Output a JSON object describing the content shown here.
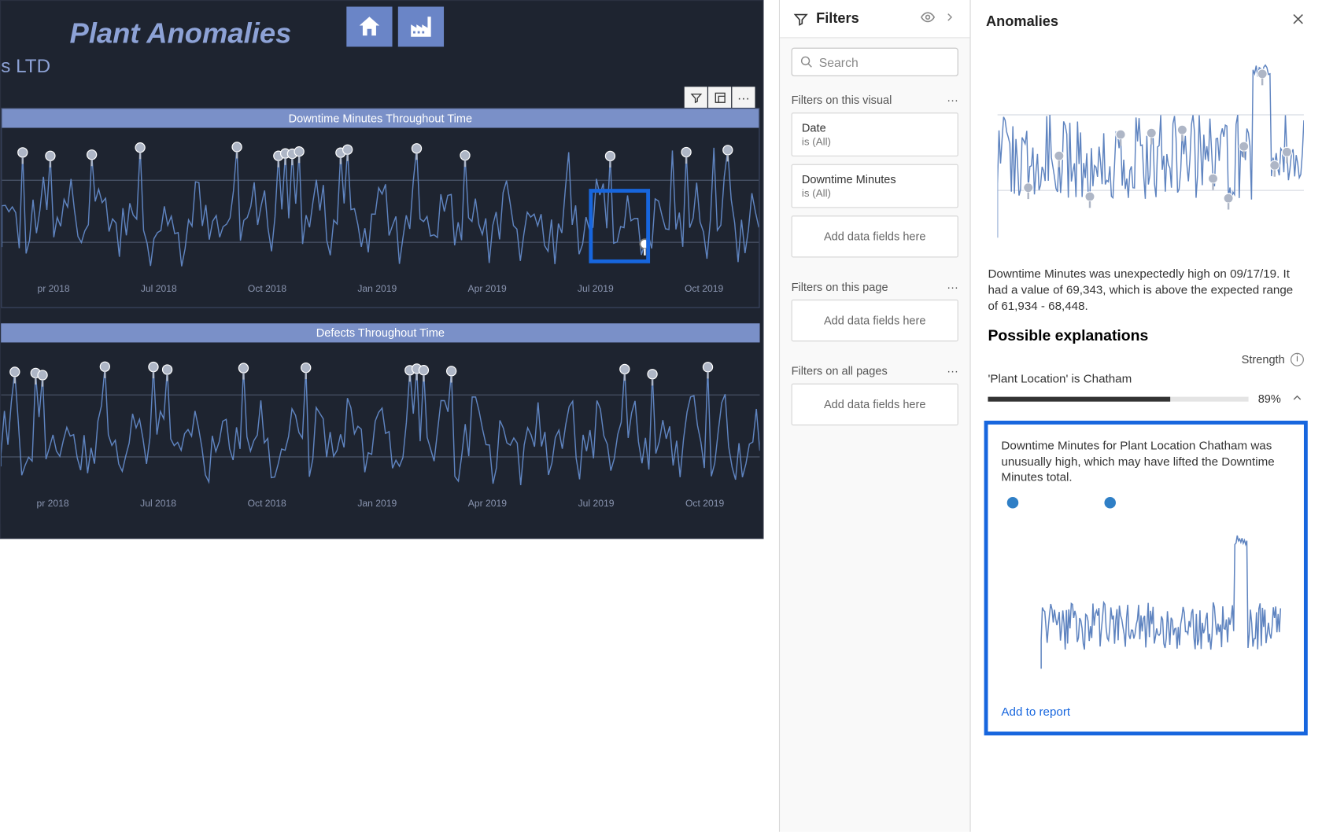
{
  "report": {
    "title": "Plant Anomalies",
    "subtitle": "s LTD",
    "nav": {
      "home": "home-icon",
      "factory": "factory-icon"
    },
    "toolbar": {
      "filter": "filter",
      "focus": "focus",
      "more": "more"
    },
    "chart1_title": "Downtime Minutes Throughout Time",
    "chart2_title": "Defects Throughout Time",
    "x_labels": [
      "pr 2018",
      "Jul 2018",
      "Oct 2018",
      "Jan 2019",
      "Apr 2019",
      "Jul 2019",
      "Oct 2019"
    ]
  },
  "filters": {
    "title": "Filters",
    "search_placeholder": "Search",
    "sec1_title": "Filters on this visual",
    "card1_field": "Date",
    "card1_val": "is (All)",
    "card2_field": "Downtime Minutes",
    "card2_val": "is (All)",
    "add_fields": "Add data fields here",
    "sec2_title": "Filters on this page",
    "sec3_title": "Filters on all pages",
    "ellipsis": "···"
  },
  "anomalies": {
    "title": "Anomalies",
    "description": "Downtime Minutes was unexpectedly high on 09/17/19. It had a value of 69,343, which is above the expected range of 61,934 - 68,448.",
    "explain_heading": "Possible explanations",
    "strength_label": "Strength",
    "explanation1_label": "'Plant Location' is Chatham",
    "strength_pct": "89%",
    "explain_text": "Downtime Minutes for Plant Location Chatham was unusually high, which may have lifted the Downtime Minutes total.",
    "add_to_report": "Add to report"
  },
  "chart_data": [
    {
      "type": "line",
      "title": "Downtime Minutes Throughout Time",
      "xlabel": "",
      "ylabel": "",
      "x_categories": [
        "Apr 2018",
        "Jul 2018",
        "Oct 2018",
        "Jan 2019",
        "Apr 2019",
        "Jul 2019",
        "Oct 2019"
      ],
      "ylim": [
        0,
        70000
      ],
      "anomaly_markers": true,
      "highlighted_point": {
        "date": "09/17/19",
        "value": 69343,
        "expected_low": 61934,
        "expected_high": 68448
      },
      "series": [
        {
          "name": "Downtime Minutes",
          "note": "dense daily series ~Apr 2018–Dec 2019; approx baseline 20k-40k with anomaly spikes up to ~69k"
        }
      ]
    },
    {
      "type": "line",
      "title": "Defects Throughout Time",
      "xlabel": "",
      "ylabel": "",
      "x_categories": [
        "Apr 2018",
        "Jul 2018",
        "Oct 2018",
        "Jan 2019",
        "Apr 2019",
        "Jul 2019",
        "Oct 2019"
      ],
      "anomaly_markers": true,
      "series": [
        {
          "name": "Defects",
          "note": "dense daily series with periodic spikes marked as anomalies"
        }
      ]
    },
    {
      "type": "line",
      "title": "Anomalies overview (mini)",
      "series": [
        {
          "name": "Downtime Minutes",
          "note": "same series as chart 1, thumbnail, spike late 2019"
        }
      ]
    },
    {
      "type": "line",
      "title": "Downtime Minutes for Plant Location Chatham",
      "series": [
        {
          "name": "Chatham",
          "note": "noisy baseline with a large spike near end"
        }
      ]
    }
  ]
}
